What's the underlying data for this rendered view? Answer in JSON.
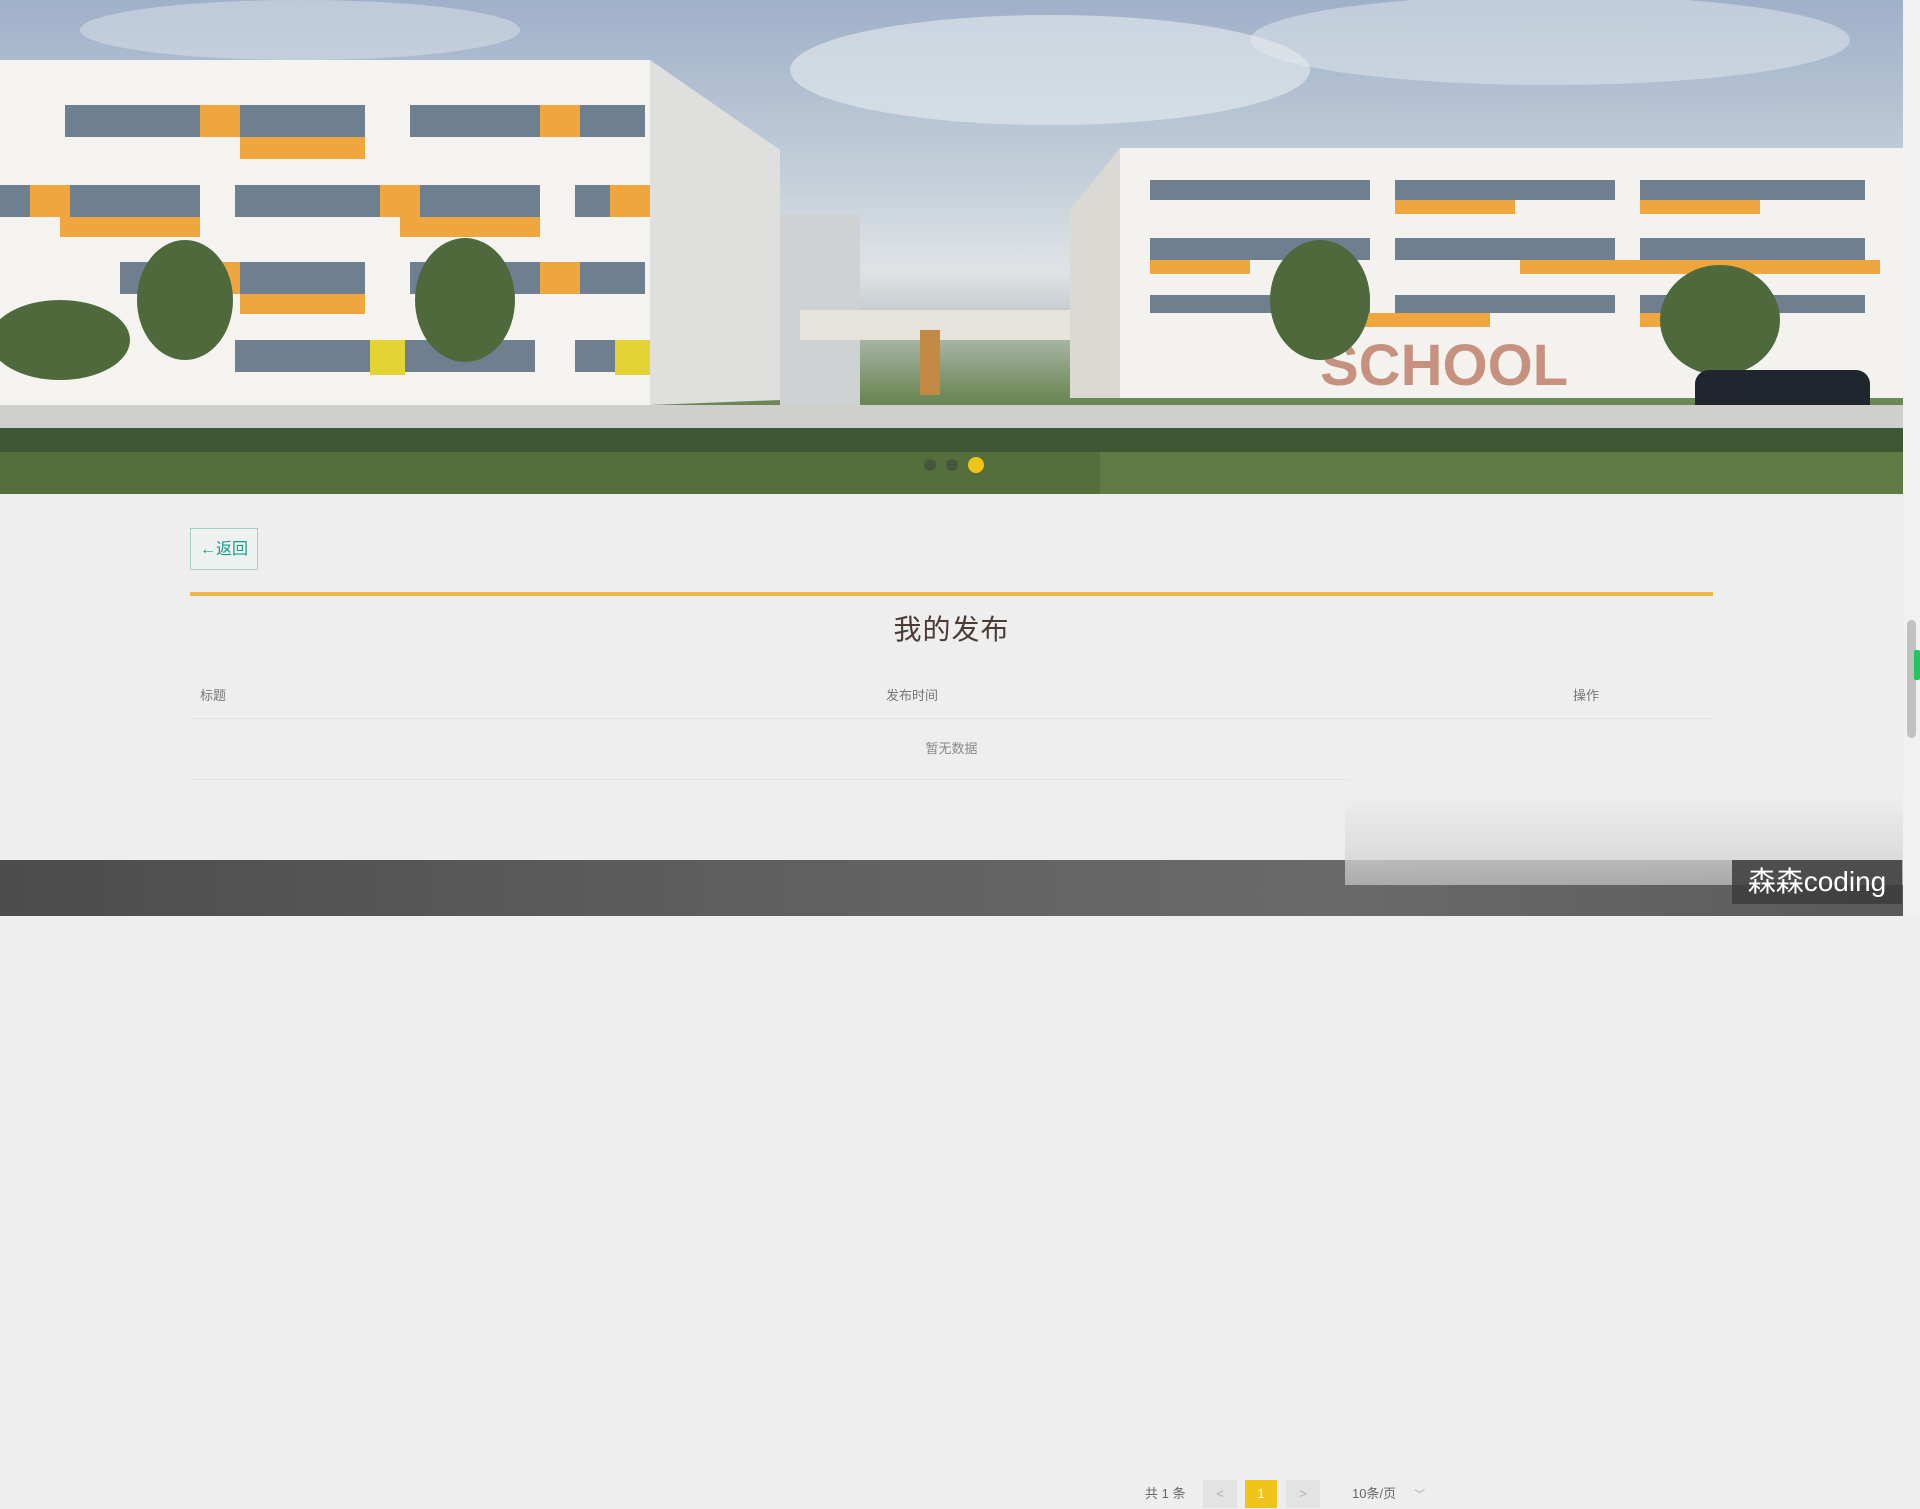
{
  "banner": {
    "image_label": "SCHOOL",
    "carousel": {
      "total": 3,
      "active": 3
    }
  },
  "back_button": {
    "label": "←返回"
  },
  "page_title": "我的发布",
  "table": {
    "columns": [
      "标题",
      "发布时间",
      "操作"
    ],
    "empty_text": "暂无数据"
  },
  "pagination": {
    "total_text": "共 1 条",
    "prev": "<",
    "current_page": "1",
    "next": ">",
    "page_size": "10条/页"
  },
  "watermark": "森森coding",
  "colors": {
    "accent": "#f0c419",
    "divider": "#f0b54a",
    "back_text": "#169c8b",
    "title": "#4a3b33"
  }
}
